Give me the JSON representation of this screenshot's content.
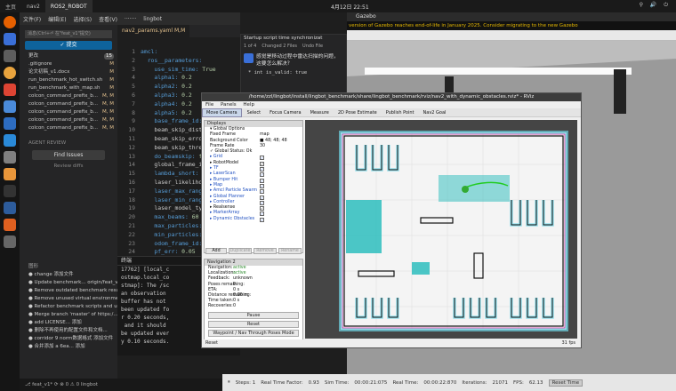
{
  "topbar": {
    "tabs": [
      "主页",
      "nav2",
      "ROS2_ROBOT"
    ],
    "clock": "4月12日 22:51",
    "tray": "⚲ 🔊 ⏻"
  },
  "vscode": {
    "menu": [
      "文件(F)",
      "编辑(E)",
      "选择(S)",
      "查看(V)",
      "·······",
      "lingbot"
    ],
    "scm_input_placeholder": "消息(Ctrl+⏎ 在\"feat_v1\"提交)",
    "commit_label": "✓ 提交",
    "changes_label": "更改",
    "changes_count": "15",
    "files": [
      {
        "name": ".gitignore",
        "status": "M"
      },
      {
        "name": "论文初稿_v1.docx",
        "status": "M"
      },
      {
        "name": "run_benchmark_hot_switch.sh",
        "status": "M"
      },
      {
        "name": "run_benchmark_with_map.sh",
        "status": "M"
      },
      {
        "name": "colcon_command_prefix_b...",
        "status": "M, M"
      },
      {
        "name": "colcon_command_prefix_b...",
        "status": "M, M"
      },
      {
        "name": "colcon_command_prefix_b...",
        "status": "M, M"
      },
      {
        "name": "colcon_command_prefix_b...",
        "status": "M, M"
      },
      {
        "name": "colcon_command_prefix_b...",
        "status": "M, M"
      }
    ],
    "agent_review": "AGENT REVIEW",
    "find_issues": "Find Issues",
    "review_diffs": "Review diffs",
    "graph_header": "图形",
    "graph": [
      "change 添加文件",
      "Update benchmark... origin/feat_v1",
      "Remove outdated benchmark result...",
      "Remove unused virtual environme...",
      "Refactor benchmark scripts and up...",
      "Merge branch 'master' of https:/...",
      "add LICENSE... 添加",
      "删除不再使用的配置文件和文档...",
      "corridor 9 norm数据格式 添加文件",
      "合并添加 a 6ea...  添加"
    ],
    "status_bar": "⎇ feat_v1*  ⟳  ⊗ 0 ⚠ 0  lingbot",
    "editor_tab": "nav2_params.yaml  M,M",
    "code_lines": [
      {
        "n": "1",
        "t": "amcl:"
      },
      {
        "n": "2",
        "t": "  ros__parameters:"
      },
      {
        "n": "3",
        "t": "    use_sim_time: True"
      },
      {
        "n": "4",
        "t": "    alpha1: 0.2"
      },
      {
        "n": "5",
        "t": "    alpha2: 0.2"
      },
      {
        "n": "6",
        "t": "    alpha3: 0.2"
      },
      {
        "n": "7",
        "t": "    alpha4: 0.2"
      },
      {
        "n": "8",
        "t": "    alpha5: 0.2"
      },
      {
        "n": "9",
        "t": "    base_frame_id: \"base_"
      },
      {
        "n": "10",
        "t": "    beam_skip_distance"
      },
      {
        "n": "11",
        "t": "    beam_skip_error_th"
      },
      {
        "n": "12",
        "t": "    beam_skip_thresh"
      },
      {
        "n": "13",
        "t": "    do_beamskip: fal"
      },
      {
        "n": "14",
        "t": "    global_frame_id"
      },
      {
        "n": "15",
        "t": "    lambda_short: 0."
      },
      {
        "n": "16",
        "t": "    laser_likelihood"
      },
      {
        "n": "17",
        "t": "    laser_max_range:"
      },
      {
        "n": "18",
        "t": "    laser_min_range:"
      },
      {
        "n": "19",
        "t": "    laser_model_type"
      },
      {
        "n": "20",
        "t": "    max_beams: 60"
      },
      {
        "n": "21",
        "t": "    max_particles: 2"
      },
      {
        "n": "22",
        "t": "    min_particles: 5"
      },
      {
        "n": "23",
        "t": "    odom_frame_id: \""
      },
      {
        "n": "24",
        "t": "    pf_err: 0.05"
      },
      {
        "n": "25",
        "t": "    pf_z: 0.99"
      },
      {
        "n": "26",
        "t": "    recovery_alpha_f"
      }
    ],
    "terminal_tab": "终端",
    "terminal_lines": [
      "17762] [local_c",
      "ostmap.local_co",
      "stmap]: The /sc",
      "an observation",
      "buffer has not",
      "been updated fo",
      "r 0.20 seconds,",
      " and it should",
      "be updated ever",
      "y 0.10 seconds."
    ]
  },
  "chat": {
    "title": "Startup script time synchronizat",
    "nav": "1 of 4",
    "files": "Changed 2 Files",
    "undo": "Undo File",
    "message": "感觉是移动过程中雷达扫描的问题，这要怎么解决?",
    "code": "* int is_valid: true"
  },
  "gazebo": {
    "title": "Gazebo",
    "banner": "version of Gazebo reaches end-of-life in January 2025. Consider migrating to the new Gazebo",
    "bottom": {
      "steps": "Steps: 1",
      "rtf_label": "Real Time Factor:",
      "rtf": "0.93",
      "sim_label": "Sim Time:",
      "sim": "00:00:21:075",
      "real_label": "Real Time:",
      "real": "00:00:22:870",
      "iter_label": "Iterations:",
      "iter": "21071",
      "fps_label": "FPS:",
      "fps": "62.13",
      "reset": "Reset Time"
    }
  },
  "rviz": {
    "title": "/home/zzl/lingbot/install/lingbot_benchmark/share/lingbot_benchmark/rviz/nav2_with_dynamic_obstacles.rviz* - RViz",
    "menu": [
      "File",
      "Panels",
      "Help"
    ],
    "tools": [
      "Move Camera",
      "Select",
      "Focus Camera",
      "Measure",
      "2D Pose Estimate",
      "Publish Point",
      "Nav2 Goal"
    ],
    "displays_title": "Displays",
    "displays": [
      {
        "label": "▾ Global Options",
        "val": "",
        "blue": false,
        "check": false
      },
      {
        "label": "   Fixed Frame",
        "val": "map",
        "blue": false,
        "check": false
      },
      {
        "label": "   Background Color",
        "val": "■ 48; 48; 48",
        "blue": false,
        "check": false
      },
      {
        "label": "   Frame Rate",
        "val": "30",
        "blue": false,
        "check": false
      },
      {
        "label": "✓ Global Status: Ok",
        "val": "",
        "blue": false,
        "check": false
      },
      {
        "label": "▸ Grid",
        "val": "",
        "blue": true,
        "check": true
      },
      {
        "label": "▸ RobotModel",
        "val": "",
        "blue": false,
        "check": true
      },
      {
        "label": "▸ TF",
        "val": "",
        "blue": true,
        "check": true
      },
      {
        "label": "▸ LaserScan",
        "val": "",
        "blue": true,
        "check": true
      },
      {
        "label": "▸ Bumper Hit",
        "val": "",
        "blue": true,
        "check": true
      },
      {
        "label": "▸ Map",
        "val": "",
        "blue": true,
        "check": true
      },
      {
        "label": "▸ Amcl Particle Swarm",
        "val": "",
        "blue": true,
        "check": true
      },
      {
        "label": "▸ Global Planner",
        "val": "",
        "blue": true,
        "check": true
      },
      {
        "label": "▸ Controller",
        "val": "",
        "blue": true,
        "check": true
      },
      {
        "label": "▸ Realsense",
        "val": "",
        "blue": false,
        "check": true
      },
      {
        "label": "▸ MarkerArray",
        "val": "",
        "blue": true,
        "check": true
      },
      {
        "label": "▸ Dynamic Obstacles",
        "val": "",
        "blue": true,
        "check": true
      }
    ],
    "buttons": [
      "Add",
      "Duplicate",
      "Remove",
      "Rename"
    ],
    "nav2_title": "Navigation 2",
    "nav2_rows": [
      {
        "k": "Navigation:",
        "v": "active",
        "g": true
      },
      {
        "k": "Localization:",
        "v": "active",
        "g": true
      },
      {
        "k": "Feedback:",
        "v": "unknown",
        "g": false
      },
      {
        "k": "Poses remaining:",
        "v": "0",
        "g": false
      },
      {
        "k": "ETA:",
        "v": "0 s",
        "g": false
      },
      {
        "k": "Distance remaining:",
        "v": "0.00 m",
        "g": false
      },
      {
        "k": "Time taken:",
        "v": "0 s",
        "g": false
      },
      {
        "k": "Recoveries:",
        "v": "0",
        "g": false
      }
    ],
    "pause": "Pause",
    "reset_btn": "Reset",
    "waypoint": "Waypoint / Nav Through Poses Mode",
    "status_reset": "Reset",
    "fps": "31 fps"
  }
}
